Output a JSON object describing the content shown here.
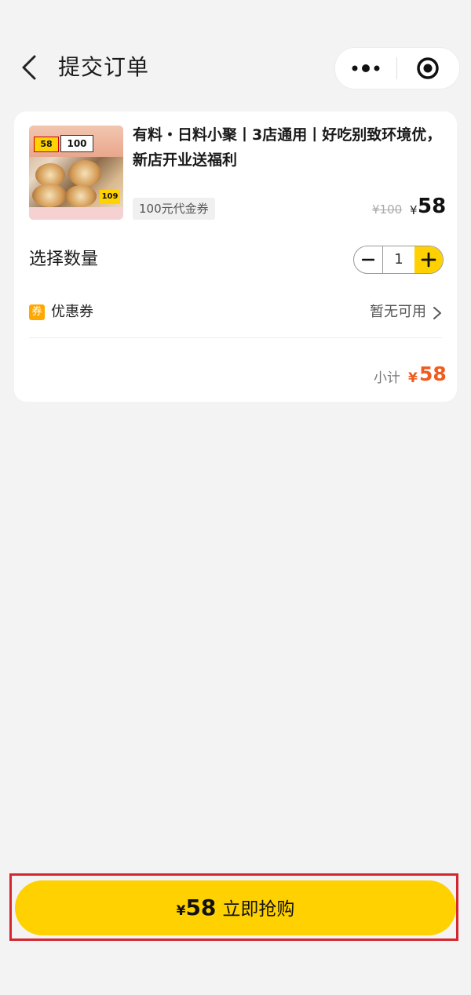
{
  "header": {
    "title": "提交订单"
  },
  "product": {
    "title": "有料・日料小聚丨3店通用丨好吃别致环境优，新店开业送福利",
    "tag": "100元代金券",
    "original_price": "¥100",
    "currency": "¥",
    "price": "58",
    "image_badges": {
      "left": "58",
      "right": "100",
      "corner": "109"
    }
  },
  "quantity": {
    "label": "选择数量",
    "value": "1"
  },
  "coupon": {
    "icon_glyph": "券",
    "label": "优惠券",
    "status": "暂无可用"
  },
  "subtotal": {
    "label": "小计",
    "currency": "¥",
    "value": "58"
  },
  "cta": {
    "currency": "¥",
    "price": "58",
    "label": "立即抢购"
  },
  "colors": {
    "accent_yellow": "#ffd100",
    "price_orange": "#ee5c1e",
    "highlight_red": "#d4262e",
    "background": "#f3f3f3"
  }
}
